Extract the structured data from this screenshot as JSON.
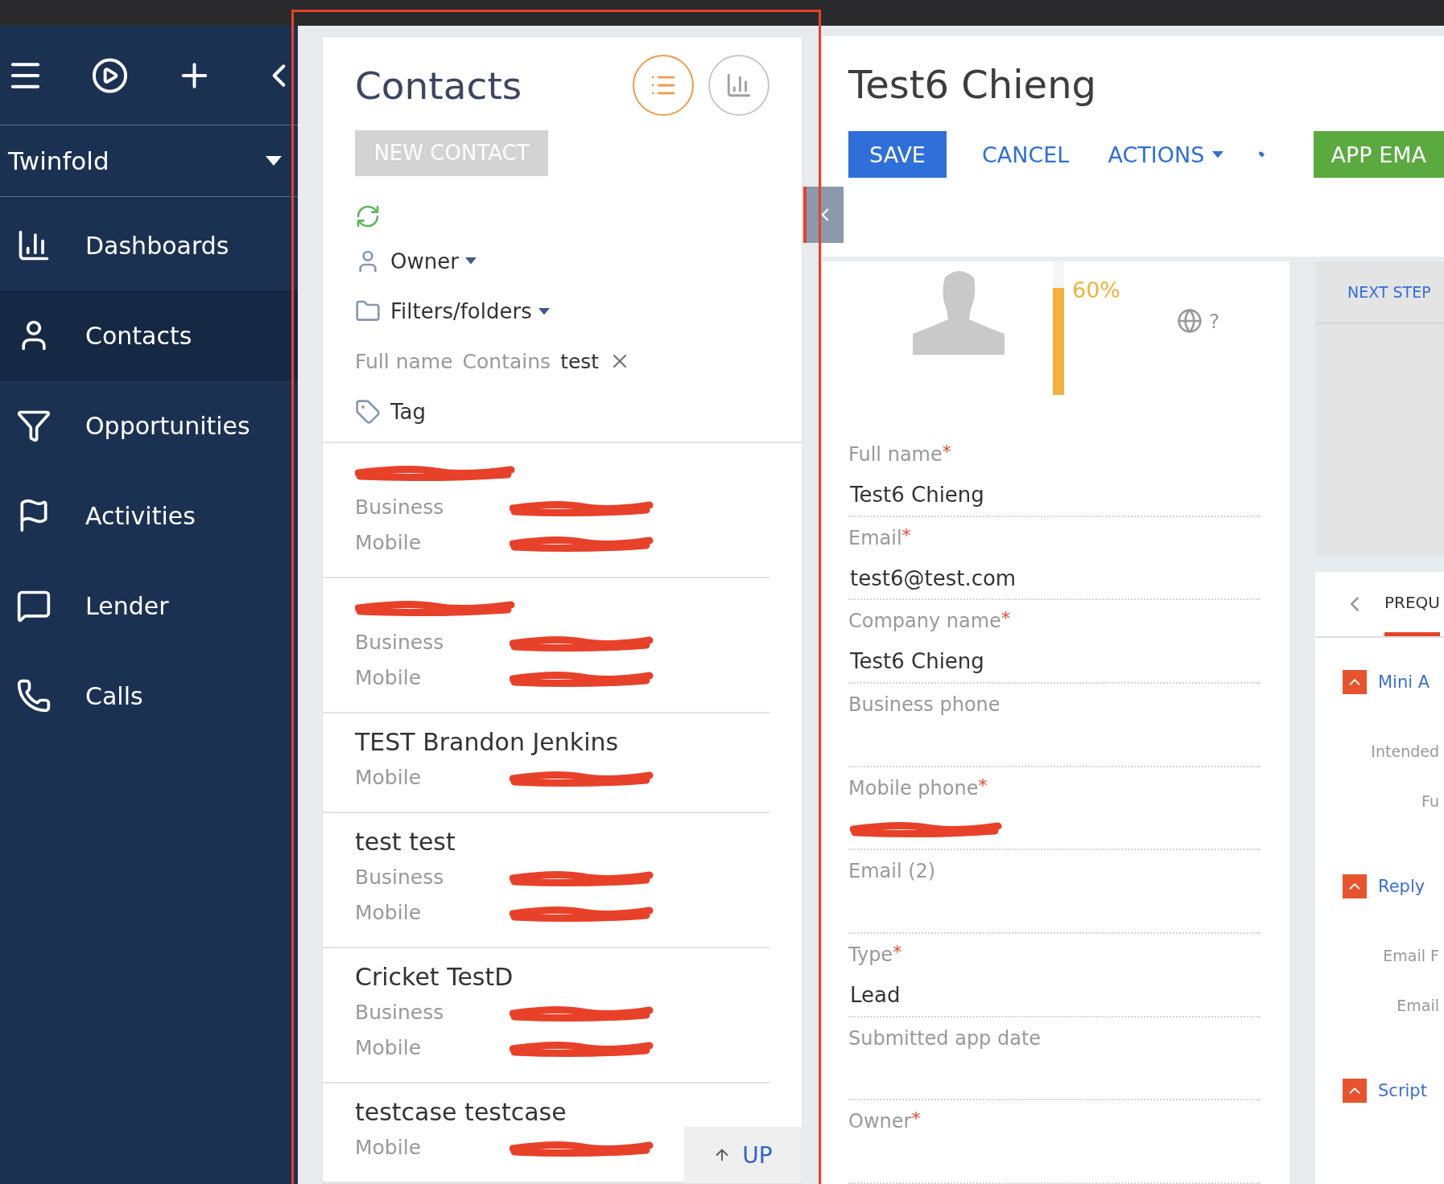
{
  "sidebar": {
    "workspace": "Twinfold",
    "items": [
      {
        "kind": "dashboards",
        "label": "Dashboards",
        "selected": false
      },
      {
        "kind": "contacts",
        "label": "Contacts",
        "selected": true
      },
      {
        "kind": "opportunities",
        "label": "Opportunities",
        "selected": false
      },
      {
        "kind": "activities",
        "label": "Activities",
        "selected": false
      },
      {
        "kind": "lender",
        "label": "Lender",
        "selected": false
      },
      {
        "kind": "calls",
        "label": "Calls",
        "selected": false
      }
    ]
  },
  "contacts": {
    "title": "Contacts",
    "views": [
      {
        "kind": "list",
        "selected": true
      },
      {
        "kind": "chart",
        "selected": false
      }
    ],
    "new_button": "NEW CONTACT",
    "filters": [
      {
        "kind": "owner",
        "label": "Owner"
      },
      {
        "kind": "folders",
        "label": "Filters/folders"
      }
    ],
    "active_filter": {
      "column": "Full name",
      "operator": "Contains",
      "value": "test"
    },
    "tag": "Tag",
    "records": [
      {
        "name_redacted": true,
        "phones": [
          {
            "label": "Business",
            "redacted": true
          },
          {
            "label": "Mobile",
            "redacted": true
          }
        ]
      },
      {
        "name_redacted": true,
        "phones": [
          {
            "label": "Business",
            "redacted": true
          },
          {
            "label": "Mobile",
            "redacted": true
          }
        ]
      },
      {
        "name": "TEST Brandon Jenkins",
        "name_redacted": false,
        "phones": [
          {
            "label": "Mobile",
            "redacted": true
          }
        ]
      },
      {
        "name": "test test",
        "name_redacted": false,
        "phones": [
          {
            "label": "Business",
            "redacted": true
          },
          {
            "label": "Mobile",
            "redacted": true
          }
        ]
      },
      {
        "name": "Cricket TestD",
        "name_redacted": false,
        "phones": [
          {
            "label": "Business",
            "redacted": true
          },
          {
            "label": "Mobile",
            "redacted": true
          }
        ]
      },
      {
        "name": "testcase testcase",
        "name_redacted": false,
        "phones": [
          {
            "label": "Mobile",
            "redacted": true
          }
        ]
      }
    ],
    "up_button": "UP"
  },
  "detail": {
    "title": "Test6 Chieng",
    "buttons": [
      {
        "kind": "primary",
        "label": "SAVE"
      },
      {
        "kind": "link",
        "label": "CANCEL"
      },
      {
        "kind": "dropdown",
        "label": "ACTIONS"
      },
      {
        "kind": "tag"
      },
      {
        "kind": "success",
        "label": "APP EMA"
      }
    ],
    "completeness": {
      "level": 0.8,
      "reading": "60%"
    },
    "timezone_hint": "?",
    "fields": [
      {
        "label": "Full name",
        "required": true,
        "required_mark": "*",
        "value": "Test6 Chieng",
        "redacted": false
      },
      {
        "label": "Email",
        "required": true,
        "required_mark": "*",
        "value": "test6@test.com",
        "redacted": false
      },
      {
        "label": "Company name",
        "required": true,
        "required_mark": "*",
        "value": "Test6 Chieng",
        "redacted": false
      },
      {
        "label": "Business phone",
        "required": false,
        "redacted": false
      },
      {
        "label": "Mobile phone",
        "required": true,
        "required_mark": "*",
        "redacted": true
      },
      {
        "label": "Email (2)",
        "required": false,
        "redacted": false
      },
      {
        "label": "Type",
        "required": true,
        "required_mark": "*",
        "value": "Lead",
        "redacted": false
      },
      {
        "label": "Submitted app date",
        "required": false,
        "redacted": false
      },
      {
        "label": "Owner",
        "required": true,
        "required_mark": "*",
        "redacted": false
      }
    ]
  },
  "side_panel": {
    "next_steps_tab": "NEXT STEP",
    "tab": "PREQU",
    "items": [
      {
        "kind": "section",
        "label": "Mini A"
      },
      {
        "kind": "field",
        "label": "Intended"
      },
      {
        "kind": "field",
        "label": "Fu"
      },
      {
        "kind": "section",
        "label": "Reply"
      },
      {
        "kind": "field",
        "label": "Email F"
      },
      {
        "kind": "field",
        "label": "Email"
      },
      {
        "kind": "section",
        "label": "Script"
      }
    ]
  }
}
